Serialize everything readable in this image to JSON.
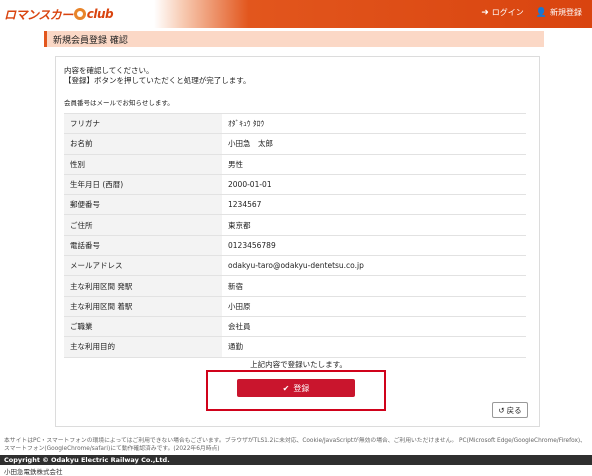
{
  "header": {
    "logo_text_1": "ロマンスカー",
    "logo_text_2": "club",
    "login_label": "ログイン",
    "signup_label": "新規登録"
  },
  "page_title": "新規会員登録 確認",
  "intro": {
    "line1": "内容を確認してください。",
    "line2": "【登録】ボタンを押していただくと処理が完了します。",
    "note": "会員番号はメールでお知らせします。"
  },
  "rows": [
    {
      "label": "フリガナ",
      "value": "ｵﾀﾞｷｭｳ ﾀﾛｳ"
    },
    {
      "label": "お名前",
      "value": "小田急　太郎"
    },
    {
      "label": "性別",
      "value": "男性"
    },
    {
      "label": "生年月日 (西暦)",
      "value": "2000-01-01"
    },
    {
      "label": "郵便番号",
      "value": "1234567"
    },
    {
      "label": "ご住所",
      "value": "東京都"
    },
    {
      "label": "電話番号",
      "value": "0123456789"
    },
    {
      "label": "メールアドレス",
      "value": "odakyu-taro@odakyu-dentetsu.co.jp"
    },
    {
      "label": "主な利用区間 発駅",
      "value": "新宿"
    },
    {
      "label": "主な利用区間 着駅",
      "value": "小田原"
    },
    {
      "label": "ご職業",
      "value": "会社員"
    },
    {
      "label": "主な利用目的",
      "value": "通勤"
    }
  ],
  "confirm_text": "上記内容で登録いたします。",
  "register_label": "登録",
  "back_label": "戻る",
  "footer": {
    "note": "本サイトはPC・スマートフォンの環境によってはご利用できない場合もございます。ブラウザがTLS1.2に未対応、Cookie/JavaScriptが無効の場合、ご利用いただけません。 PC(Microsoft Edge/GoogleChrome/Firefox)、スマートフォン(GoogleChrome/safari)にて動作確認済みです。(2022年6月時点)",
    "copyright": "Copyright © Odakyu Electric Railway Co.,Ltd.",
    "company": "小田急電鉄株式会社"
  },
  "colors": {
    "accent": "#e2561d",
    "register": "#c9152d",
    "highlight": "#d0021b"
  }
}
